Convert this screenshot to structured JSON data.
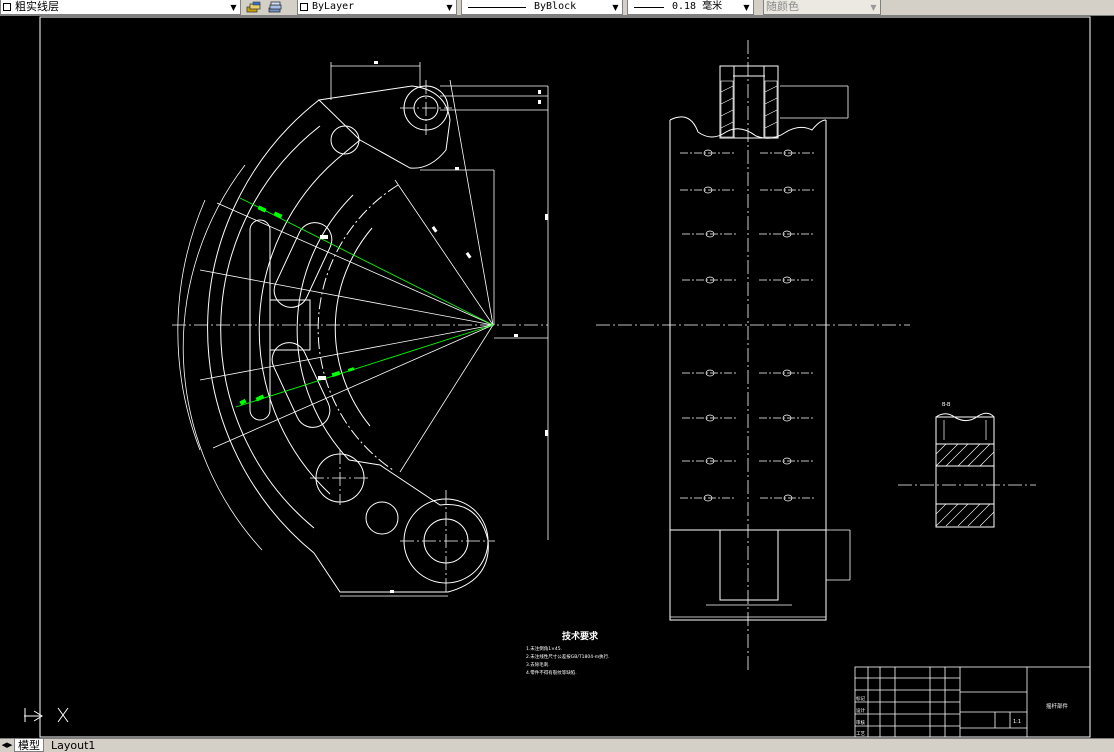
{
  "toolbar": {
    "layer": {
      "value": "粗实线层",
      "icon": "square-icon"
    },
    "layer_tools": [
      "layer-state-icon",
      "layer-stack-icon"
    ],
    "color": {
      "value": "ByLayer",
      "icon": "square-icon"
    },
    "linetype": {
      "value": "ByBlock"
    },
    "lineweight": {
      "value": "0.18 毫米"
    },
    "plotstyle": {
      "value": "随颜色",
      "enabled": false
    }
  },
  "drawing": {
    "background": "#000000",
    "line_color": "#ffffff",
    "highlight_color": "#00ff00",
    "tech_requirements": {
      "title": "技术要求",
      "items": [
        "1.未注倒角1×45.",
        "2.未注线性尺寸公差按GB/T1804-m执行.",
        "3.去除毛刺.",
        "4.零件不得有裂纹等缺陷."
      ]
    },
    "section_label": "B-B",
    "title_block": {
      "part_name": "摇杆部件",
      "scale": "1:1",
      "rows": [
        "标记",
        "设计",
        "审核",
        "工艺"
      ]
    },
    "ucs_icon": "ucs-axis-icon"
  },
  "tabs": {
    "items": [
      {
        "label": "模型",
        "active": true
      },
      {
        "label": "Layout1",
        "active": false
      }
    ],
    "nav_icon": "tab-scroll-arrows-icon"
  }
}
